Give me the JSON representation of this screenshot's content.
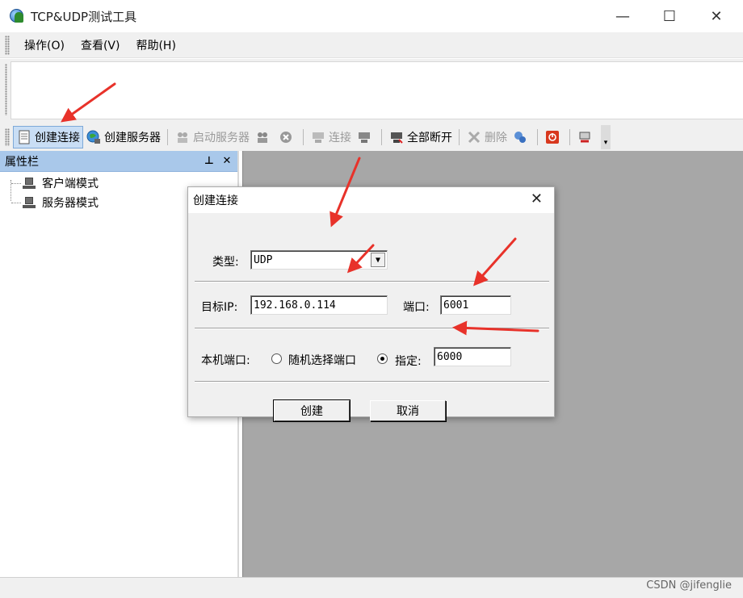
{
  "window": {
    "title": "TCP&UDP测试工具",
    "minimize": "—",
    "maximize": "☐",
    "close": "✕"
  },
  "menubar": {
    "items": [
      "操作(O)",
      "查看(V)",
      "帮助(H)"
    ]
  },
  "toolbar": {
    "create_connection": "创建连接",
    "create_server": "创建服务器",
    "start_server": "启动服务器",
    "connect": "连接",
    "disconnect_all": "全部断开",
    "delete": "删除"
  },
  "property_panel": {
    "title": "属性栏",
    "pin": "⊥",
    "close": "✕",
    "tree_items": [
      "客户端模式",
      "服务器模式"
    ]
  },
  "dialog": {
    "title": "创建连接",
    "close": "✕",
    "type_label": "类型:",
    "type_value": "UDP",
    "target_ip_label": "目标IP:",
    "target_ip_value": "192.168.0.114",
    "port_label": "端口:",
    "port_value": "6001",
    "local_port_label": "本机端口:",
    "random_port_label": "随机选择端口",
    "specify_label": "指定:",
    "specify_value": "6000",
    "create_button": "创建",
    "cancel_button": "取消",
    "random_selected": false,
    "specify_selected": true
  },
  "watermark": "CSDN @jifenglie",
  "colors": {
    "panel_header": "#a9c8ea",
    "mdi_background": "#a7a7a7",
    "annotation_arrow": "#e8322a",
    "active_button": "#c9def5"
  }
}
